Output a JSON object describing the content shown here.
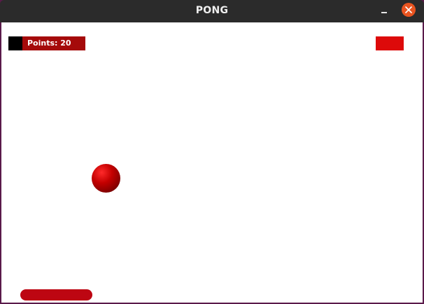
{
  "window": {
    "title": "PONG"
  },
  "hud": {
    "points_text": "Points: 20",
    "points": 20
  },
  "icons": {
    "minimize": "minimize-icon",
    "close": "close-icon"
  },
  "colors": {
    "titlebar": "#2b2b2b",
    "close_button": "#e95420",
    "score_box": "#a50a0a",
    "top_paddle": "#dd0a0a",
    "ball": "#c40000",
    "bottom_paddle": "#bd0612",
    "canvas": "#ffffff"
  }
}
